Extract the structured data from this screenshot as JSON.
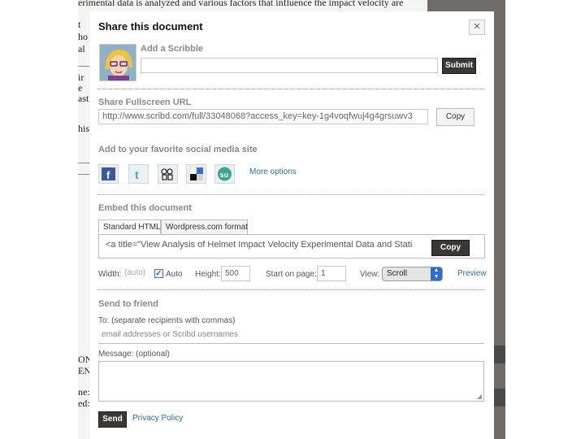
{
  "background": {
    "lines_top": [
      "erimental data is analyzed and various factors that influence the impact velocity are"
    ],
    "fragments": [
      "t",
      "ho",
      "al",
      "ir",
      "e",
      "ast",
      "his",
      "ON",
      "EN",
      "ne:",
      "ed:"
    ]
  },
  "dialog": {
    "title": "Share this document",
    "close_glyph": "×",
    "scribble": {
      "label": "Add a Scribble",
      "value": "",
      "submit": "Submit"
    },
    "fullscreen": {
      "label": "Share Fullscreen URL",
      "url": "http://www.scribd.com/full/33048068?access_key=key-1g4voqfwuj4g4grsuwv3",
      "copy": "Copy"
    },
    "social": {
      "label": "Add to your favorite social media site",
      "icons": [
        "facebook-icon",
        "twitter-icon",
        "myspace-icon",
        "delicious-icon",
        "stumbleupon-icon"
      ],
      "more": "More options"
    },
    "embed": {
      "label": "Embed this document",
      "tabs": [
        "Standard HTML",
        "Wordpress.com format"
      ],
      "code": "<a title=\"View Analysis of Helmet Impact Velocity Experimental Data and Stati",
      "copy": "Copy",
      "width_label": "Width:",
      "width_placeholder": "(auto)",
      "auto_label": "Auto",
      "auto_checked": true,
      "height_label": "Height:",
      "height_value": "500",
      "start_label": "Start on page:",
      "start_value": "1",
      "view_label": "View:",
      "view_value": "Scroll",
      "preview": "Preview"
    },
    "friend": {
      "label": "Send to friend",
      "to_label": "To: (separate recipients with commas)",
      "to_placeholder": "email addresses or Scribd usernames",
      "message_label": "Message: (optional)",
      "message_value": "",
      "send": "Send",
      "privacy": "Privacy Policy"
    }
  },
  "colors": {
    "link": "#2b6c9e",
    "dark_button": "#3b3735",
    "backdrop": "#6f6b69"
  }
}
